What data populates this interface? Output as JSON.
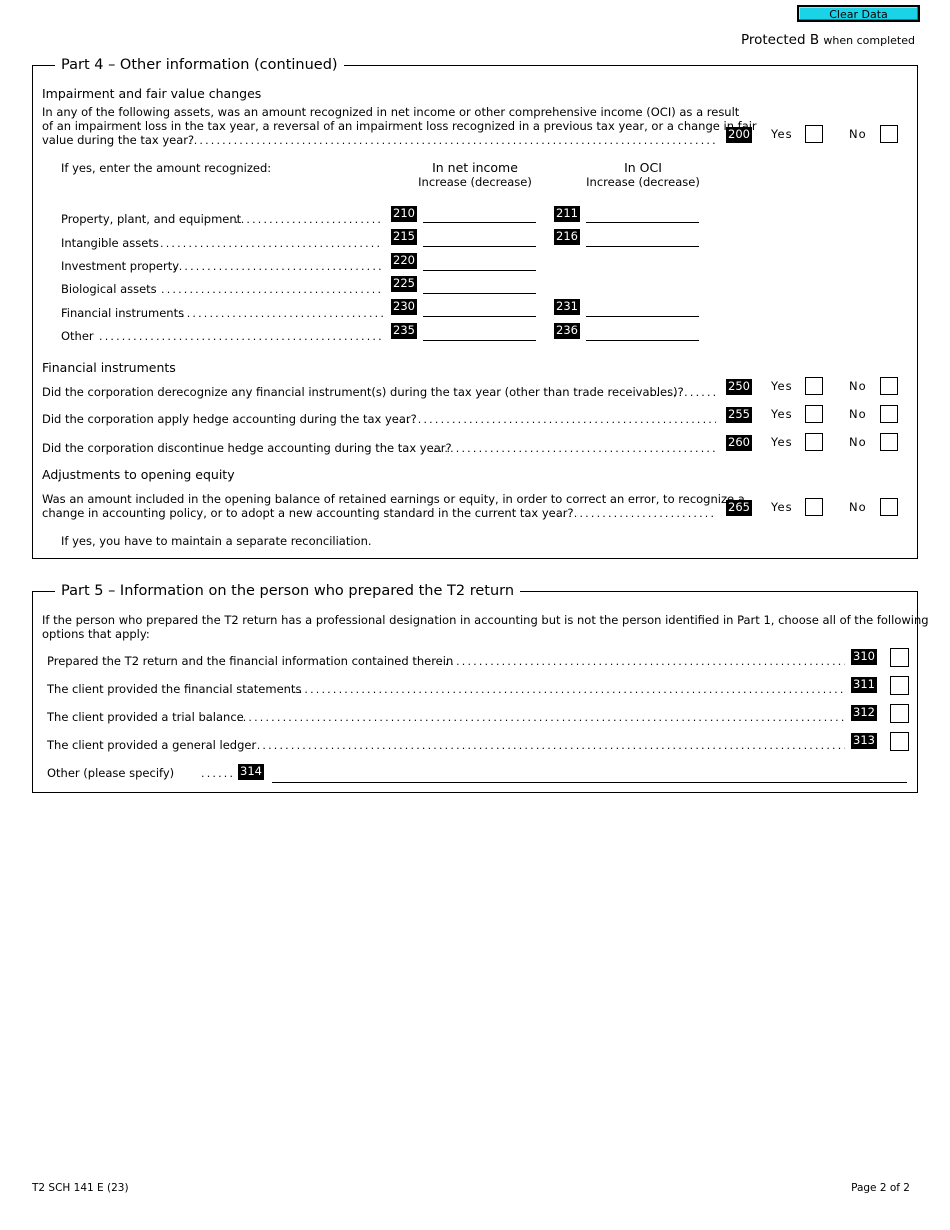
{
  "header": {
    "clear_button": "Clear Data",
    "protected_label": "Protected B",
    "protected_suffix": "when completed",
    "accent_color": "#1ad3e6"
  },
  "part4": {
    "title": "Part 4 – Other information (continued)",
    "impairment": {
      "heading": "Impairment and fair value changes",
      "question_lines": [
        "In any of the following assets, was an amount recognized in net income or other comprehensive income (OCI) as a result",
        "of an impairment loss in the tax year, a reversal of an impairment loss recognized in a previous tax year, or a change in fair",
        "value during the tax year?"
      ],
      "code": "200",
      "yes_label": "Yes",
      "no_label": "No",
      "if_yes": "If yes, enter the amount recognized:",
      "col1_title": "In net income",
      "col1_sub": "Increase (decrease)",
      "col2_title": "In OCI",
      "col2_sub": "Increase (decrease)",
      "rows": [
        {
          "label": "Property, plant, and equipment",
          "code_ni": "210",
          "value_ni": "",
          "code_oci": "211",
          "value_oci": ""
        },
        {
          "label": "Intangible assets",
          "code_ni": "215",
          "value_ni": "",
          "code_oci": "216",
          "value_oci": ""
        },
        {
          "label": "Investment property",
          "code_ni": "220",
          "value_ni": ""
        },
        {
          "label": "Biological assets",
          "code_ni": "225",
          "value_ni": ""
        },
        {
          "label": "Financial instruments",
          "code_ni": "230",
          "value_ni": "",
          "code_oci": "231",
          "value_oci": ""
        },
        {
          "label": "Other",
          "code_ni": "235",
          "value_ni": "",
          "code_oci": "236",
          "value_oci": ""
        }
      ]
    },
    "financial": {
      "heading": "Financial instruments",
      "questions": [
        {
          "text": "Did the corporation derecognize any financial instrument(s) during the tax year (other than trade receivables)?",
          "code": "250"
        },
        {
          "text": "Did the corporation apply hedge accounting during the tax year?",
          "code": "255"
        },
        {
          "text": "Did the corporation discontinue hedge accounting during the tax year?",
          "code": "260"
        }
      ]
    },
    "equity": {
      "heading": "Adjustments to opening equity",
      "question_lines": [
        "Was an amount included in the opening balance of retained earnings or equity, in order to correct an error, to recognize a",
        "change in accounting policy, or to adopt a new accounting standard in the current tax year?"
      ],
      "code": "265",
      "note": "If yes, you have to maintain a separate reconciliation."
    }
  },
  "part5": {
    "title": "Part 5 – Information on the person who prepared the T2 return",
    "intro_lines": [
      "If the person who prepared the T2 return has a professional designation in accounting but is not the person identified in Part 1, choose all of the following",
      "options that apply:"
    ],
    "options": [
      {
        "label": "Prepared the T2 return and the financial information contained therein",
        "code": "310"
      },
      {
        "label": "The client provided the financial statements",
        "code": "311"
      },
      {
        "label": "The client provided a trial balance",
        "code": "312"
      },
      {
        "label": "The client provided a general ledger",
        "code": "313"
      }
    ],
    "other_label": "Other (please specify)",
    "other_code": "314",
    "other_value": ""
  },
  "footer": {
    "form_id": "T2 SCH 141 E (23)",
    "page": "Page 2 of 2"
  }
}
